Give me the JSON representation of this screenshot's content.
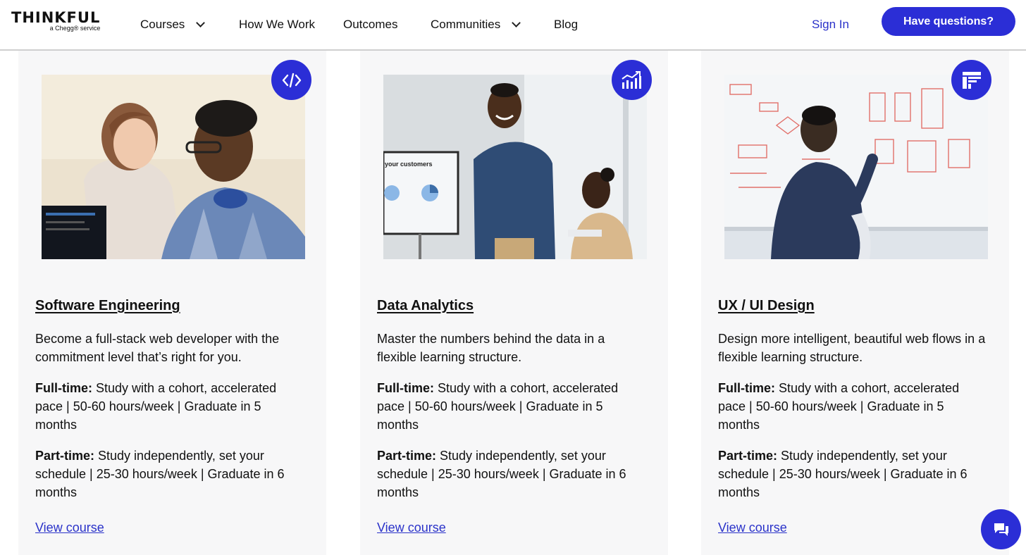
{
  "header": {
    "logo": "THINKFUL",
    "logo_sub": "a Chegg® service",
    "nav": [
      "Courses",
      "How We Work",
      "Outcomes",
      "Communities",
      "Blog"
    ],
    "sign_in": "Sign In",
    "cta": "Have questions?"
  },
  "colors": {
    "accent": "#2b2ed6",
    "link": "#2a32c9",
    "card_bg": "#f7f7f8"
  },
  "cards": [
    {
      "icon": "code-icon",
      "title": "Software Engineering",
      "desc": "Become a full-stack web developer with the commitment level that’s right for you.",
      "ft_label": "Full-time:",
      "ft_text": "Study with a cohort, accelerated pace | 50-60 hours/week | Graduate in 5 months",
      "pt_label": "Part-time:",
      "pt_text": "Study independently, set your schedule | 25-30 hours/week | Graduate in 6 months",
      "link": "View course"
    },
    {
      "icon": "bar-chart-icon",
      "title": "Data Analytics",
      "desc": "Master the numbers behind the data in a flexible learning structure.",
      "ft_label": "Full-time:",
      "ft_text": "Study with a cohort, accelerated pace | 50-60 hours/week | Graduate in 5 months",
      "pt_label": "Part-time:",
      "pt_text": "Study independently, set your schedule | 25-30 hours/week | Graduate in 6 months",
      "link": "View course",
      "screen_text": "your customers"
    },
    {
      "icon": "layout-icon",
      "title": "UX / UI Design",
      "desc": "Design more intelligent, beautiful web flows in a flexible learning structure.",
      "ft_label": "Full-time:",
      "ft_text": "Study with a cohort, accelerated pace | 50-60 hours/week | Graduate in 5 months",
      "pt_label": "Part-time:",
      "pt_text": "Study independently, set your schedule | 25-30 hours/week | Graduate in 6 months",
      "link": "View course"
    }
  ],
  "chat_icon": "chat-icon"
}
